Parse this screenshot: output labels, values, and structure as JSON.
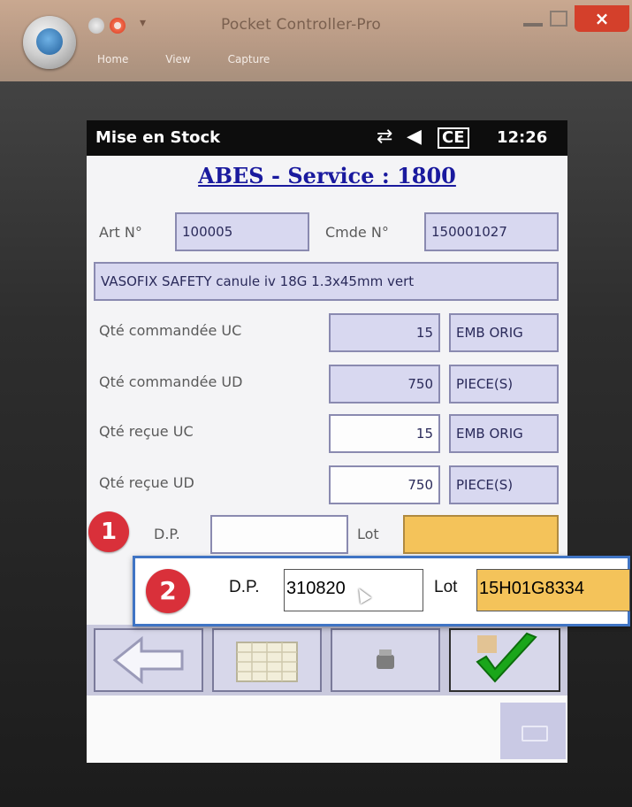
{
  "window": {
    "title": "Pocket Controller-Pro",
    "close_glyph": "×",
    "ribbon_tabs": [
      "Home",
      "View",
      "Capture"
    ]
  },
  "device": {
    "status": {
      "title": "Mise en Stock",
      "sync_icon": "⇄",
      "volume_icon": "◀",
      "ce_label": "CE",
      "time": "12:26"
    },
    "form": {
      "service_title": "ABES - Service : 1800",
      "art_label": "Art N°",
      "art_value": "100005",
      "cmde_label": "Cmde N°",
      "cmde_value": "150001027",
      "description": "VASOFIX SAFETY canule iv 18G 1.3x45mm vert",
      "rows": [
        {
          "label": "Qté commandée UC",
          "value": "15",
          "unit": "EMB ORIG"
        },
        {
          "label": "Qté commandée UD",
          "value": "750",
          "unit": "PIECE(S)"
        },
        {
          "label": "Qté reçue UC",
          "value": "15",
          "unit": "EMB ORIG"
        },
        {
          "label": "Qté reçue UD",
          "value": "750",
          "unit": "PIECE(S)"
        }
      ],
      "badge1": "1",
      "dp_label": "D.P.",
      "dp_value": "",
      "lot_label": "Lot",
      "lot_value": ""
    }
  },
  "callout": {
    "badge": "2",
    "dp_label": "D.P.",
    "dp_value": "310820",
    "lot_label": "Lot",
    "lot_value": "15H01G8334"
  },
  "colors": {
    "accent_title": "#1a1a9e",
    "field_bg": "#d8d8f0",
    "lot_highlight": "#f4c35a",
    "badge": "#d9303a",
    "callout_border": "#3f74c4",
    "check_green": "#1aa61a"
  },
  "icons": [
    "back-arrow-icon",
    "calendar-grid-icon",
    "printer-icon",
    "checkmark-icon",
    "keyboard-icon"
  ]
}
